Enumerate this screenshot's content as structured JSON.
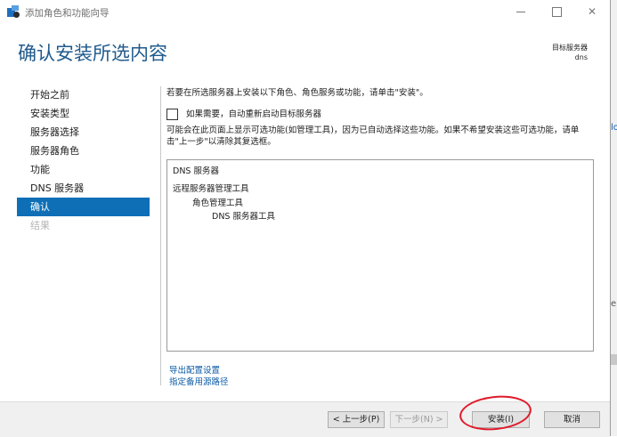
{
  "window": {
    "title": "添加角色和功能向导"
  },
  "header": {
    "title": "确认安装所选内容",
    "target_label": "目标服务器",
    "target_value": "dns"
  },
  "nav": {
    "items": [
      {
        "label": "开始之前",
        "state": "normal"
      },
      {
        "label": "安装类型",
        "state": "normal"
      },
      {
        "label": "服务器选择",
        "state": "normal"
      },
      {
        "label": "服务器角色",
        "state": "normal"
      },
      {
        "label": "功能",
        "state": "normal"
      },
      {
        "label": "DNS 服务器",
        "state": "normal"
      },
      {
        "label": "确认",
        "state": "active"
      },
      {
        "label": "结果",
        "state": "disabled"
      }
    ]
  },
  "content": {
    "intro": "若要在所选服务器上安装以下角色、角色服务或功能，请单击\"安装\"。",
    "restart_checkbox": {
      "label": "如果需要，自动重新启动目标服务器",
      "checked": false
    },
    "note": "可能会在此页面上显示可选功能(如管理工具)，因为已自动选择这些功能。如果不希望安装这些可选功能，请单击\"上一步\"以清除其复选框。",
    "features": [
      "DNS 服务器",
      "远程服务器管理工具",
      "角色管理工具",
      "DNS 服务器工具"
    ],
    "links": {
      "export": "导出配置设置",
      "alt_source": "指定备用源路径"
    }
  },
  "footer": {
    "prev": "< 上一步(P)",
    "next": "下一步(N) >",
    "install": "安装(I)",
    "cancel": "取消"
  },
  "colors": {
    "accent": "#0e6fb6",
    "title": "#1f5a8c",
    "link": "#0a5aa6",
    "annotation": "#e01a2a"
  },
  "background_fragments": [
    "lo",
    "e"
  ]
}
